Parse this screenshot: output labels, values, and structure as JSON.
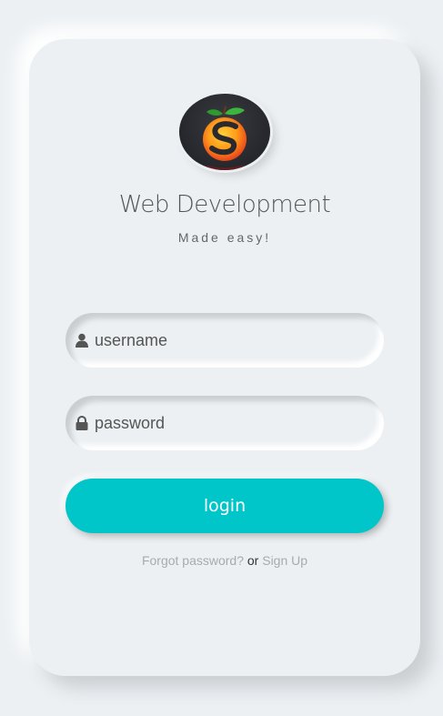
{
  "brand": {
    "logo_icon": "orange-fruit-s-logo-icon",
    "title": "Web Development",
    "subtitle": "Made easy!"
  },
  "form": {
    "username": {
      "icon": "user-icon",
      "placeholder": "username",
      "value": ""
    },
    "password": {
      "icon": "lock-icon",
      "placeholder": "password",
      "value": ""
    },
    "login_label": "login"
  },
  "links": {
    "forgot_label": "Forgot password?",
    "separator": "or",
    "signup_label": "Sign Up"
  },
  "colors": {
    "background": "#ecf0f3",
    "accent": "#00c6c9",
    "text": "#555555",
    "link": "#aaaaaa"
  }
}
